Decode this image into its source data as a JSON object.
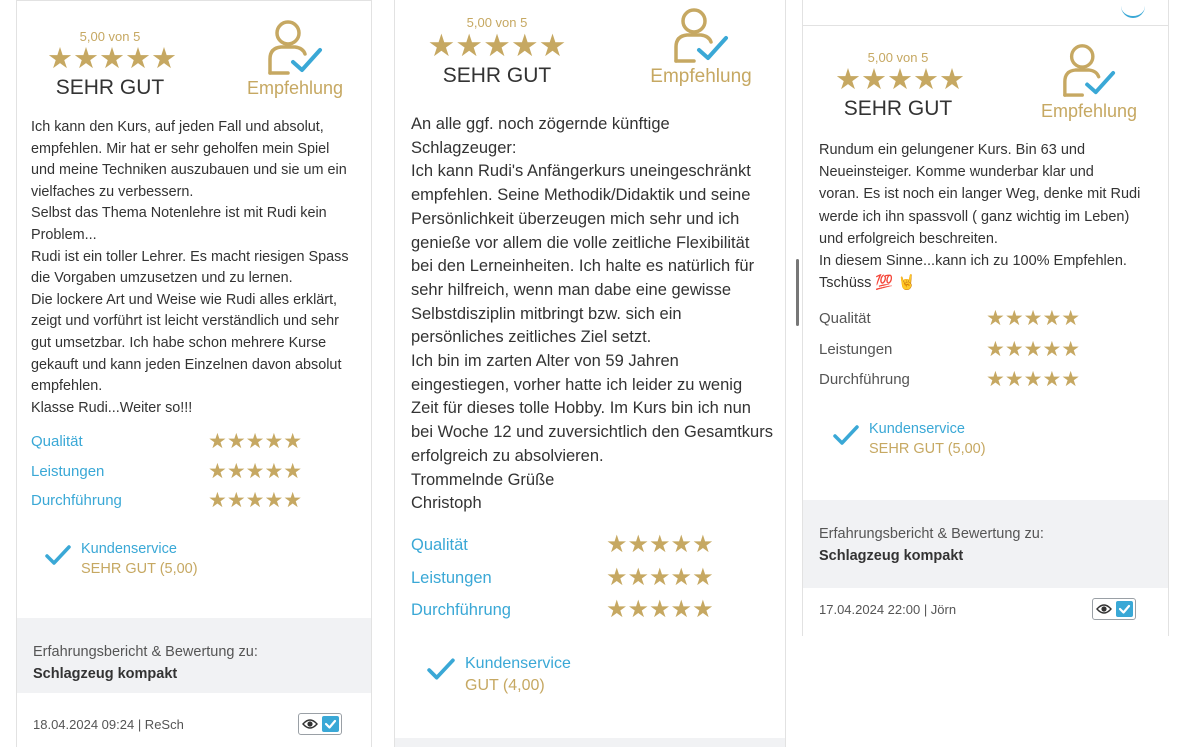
{
  "colors": {
    "gold": "#c6a862",
    "accent_blue": "#3aa8d6",
    "text": "#333333",
    "panel_bg": "#f1f2f4"
  },
  "reviews": [
    {
      "score_text": "5,00 von 5",
      "stars": "★★★★★",
      "rating_label": "SEHR GUT",
      "recommend_label": "Empfehlung",
      "text": "Ich kann den Kurs, auf jeden Fall und absolut,\nempfehlen. Mir hat er sehr geholfen mein Spiel\nund meine Techniken auszubauen und sie um ein\nvielfaches zu verbessern.\nSelbst das Thema Notenlehre ist mit Rudi kein\nProblem...\nRudi ist ein toller Lehrer. Es macht riesigen Spass\ndie Vorgaben umzusetzen und zu lernen.\nDie lockere Art und Weise wie Rudi alles erklärt,\nzeigt und vorführt ist leicht verständlich und sehr\ngut umsetzbar. Ich habe schon mehrere Kurse\ngekauft und kann jeden Einzelnen davon absolut\nempfehlen.\nKlasse Rudi...Weiter so!!!",
      "criteria": [
        {
          "label": "Qualität",
          "stars": "★★★★★"
        },
        {
          "label": "Leistungen",
          "stars": "★★★★★"
        },
        {
          "label": "Durchführung",
          "stars": "★★★★★"
        }
      ],
      "service_label": "Kundenservice",
      "service_value": "SEHR GUT (5,00)",
      "product_intro": "Erfahrungsbericht & Bewertung zu:",
      "product_name": "Schlagzeug kompakt",
      "meta": "18.04.2024 09:24 | ReSch"
    },
    {
      "score_text": "5,00 von 5",
      "stars": "★★★★★",
      "rating_label": "SEHR GUT",
      "recommend_label": "Empfehlung",
      "text": "An alle ggf. noch zögernde künftige\nSchlagzeuger:\nIch kann Rudi's Anfängerkurs uneingeschränkt\nempfehlen. Seine Methodik/Didaktik und seine\nPersönlichkeit überzeugen mich sehr und ich\ngenieße vor allem die volle zeitliche Flexibilität\nbei den Lerneinheiten. Ich halte es natürlich für\nsehr hilfreich, wenn man dabe eine gewisse\nSelbstdisziplin mitbringt bzw. sich ein\npersönliches zeitliches Ziel setzt.\nIch bin im zarten Alter von 59 Jahren\neingestiegen, vorher hatte ich leider zu wenig\nZeit für dieses tolle Hobby. Im Kurs bin ich nun\nbei Woche 12 und zuversichtlich den Gesamtkurs\nerfolgreich zu absolvieren.\nTrommelnde Grüße\nChristoph",
      "criteria": [
        {
          "label": "Qualität",
          "stars": "★★★★★"
        },
        {
          "label": "Leistungen",
          "stars": "★★★★★"
        },
        {
          "label": "Durchführung",
          "stars": "★★★★★"
        }
      ],
      "service_label": "Kundenservice",
      "service_value": "GUT (4,00)"
    },
    {
      "score_text": "5,00 von 5",
      "stars": "★★★★★",
      "rating_label": "SEHR GUT",
      "recommend_label": "Empfehlung",
      "text": "Rundum ein gelungener Kurs. Bin 63 und\nNeueinsteiger. Komme wunderbar klar und\nvoran. Es ist noch ein langer Weg, denke mit Rudi\nwerde ich ihn spassvoll ( ganz wichtig im Leben)\nund erfolgreich beschreiten.\nIn diesem Sinne...kann ich zu 100% Empfehlen.\nTschüss 💯 🤘",
      "criteria": [
        {
          "label": "Qualität",
          "stars": "★★★★★"
        },
        {
          "label": "Leistungen",
          "stars": "★★★★★"
        },
        {
          "label": "Durchführung",
          "stars": "★★★★★"
        }
      ],
      "service_label": "Kundenservice",
      "service_value": "SEHR GUT (5,00)",
      "product_intro": "Erfahrungsbericht & Bewertung zu:",
      "product_name": "Schlagzeug kompakt",
      "meta": "17.04.2024 22:00 | Jörn"
    }
  ]
}
